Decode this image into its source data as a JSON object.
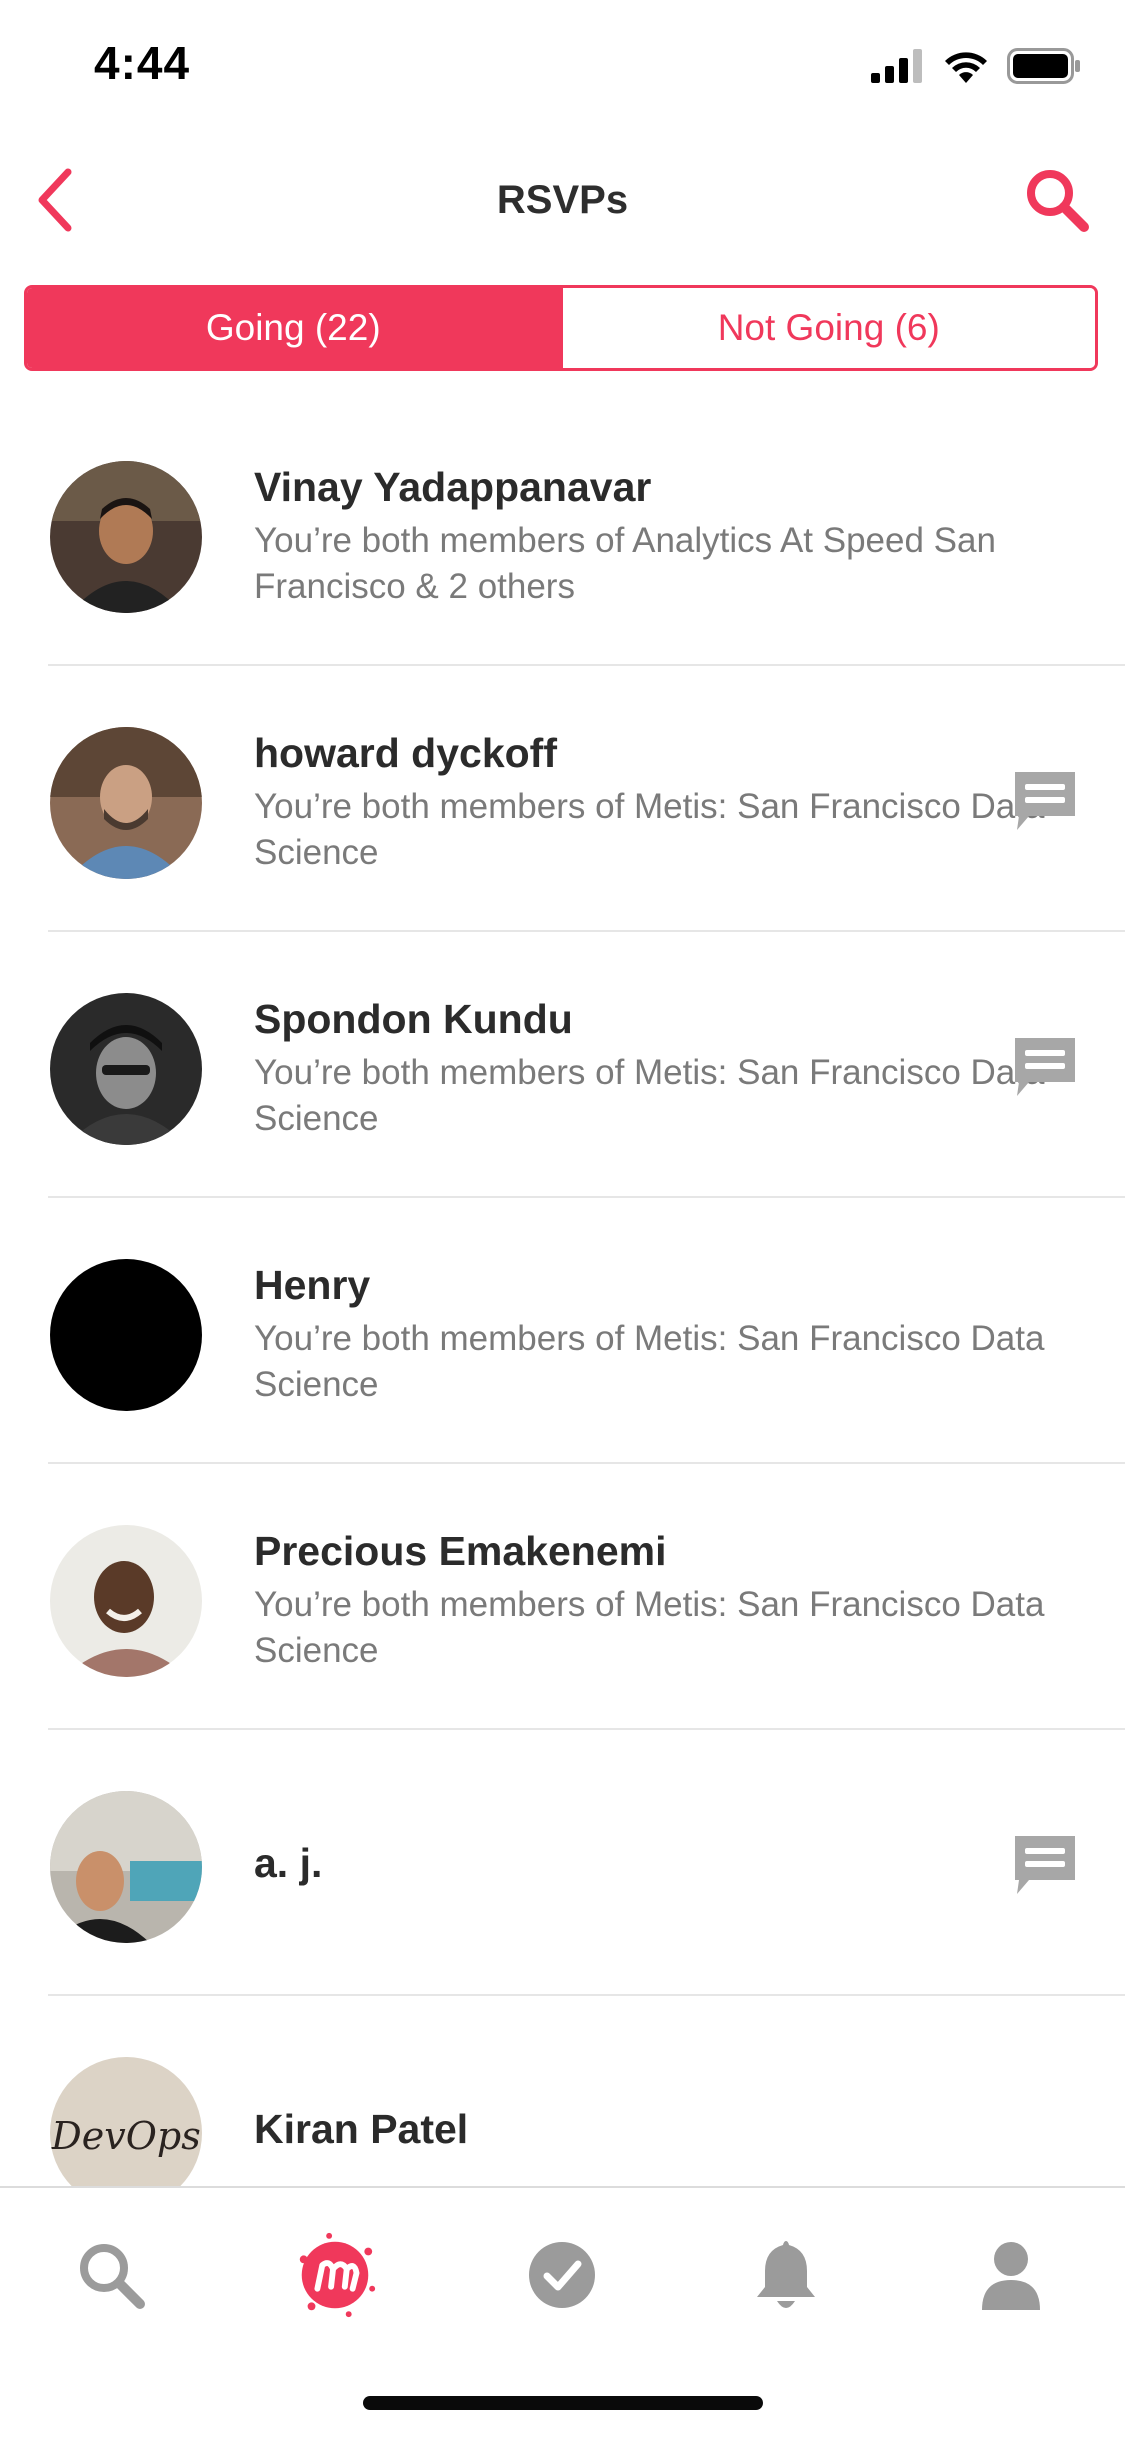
{
  "status_bar": {
    "time": "4:44"
  },
  "nav": {
    "title": "RSVPs"
  },
  "segments": {
    "going": "Going (22)",
    "not_going": "Not Going (6)"
  },
  "rows": [
    {
      "name": "Vinay Yadappanavar",
      "sub": "You’re both members of Analytics At Speed San Francisco & 2 others",
      "message": false
    },
    {
      "name": "howard dyckoff",
      "sub": "You’re both members of Metis: San Francisco Data Science",
      "message": true
    },
    {
      "name": "Spondon Kundu",
      "sub": "You’re both members of Metis: San Francisco Data Science",
      "message": true
    },
    {
      "name": "Henry",
      "sub": "You’re both members of Metis: San Francisco Data Science",
      "message": false
    },
    {
      "name": "Precious Emakenemi",
      "sub": "You’re both members of Metis: San Francisco Data Science",
      "message": false
    },
    {
      "name": "a. j.",
      "sub": "",
      "message": true
    },
    {
      "name": "Kiran Patel",
      "sub": "",
      "message": false,
      "avatar_text": "DevOps"
    }
  ],
  "tabbar": {
    "items": [
      "search-icon",
      "meetup-logo-icon",
      "checkmark-icon",
      "bell-icon",
      "profile-icon"
    ]
  },
  "colors": {
    "accent": "#f0385b",
    "icon_gray": "#9b9b9b"
  }
}
